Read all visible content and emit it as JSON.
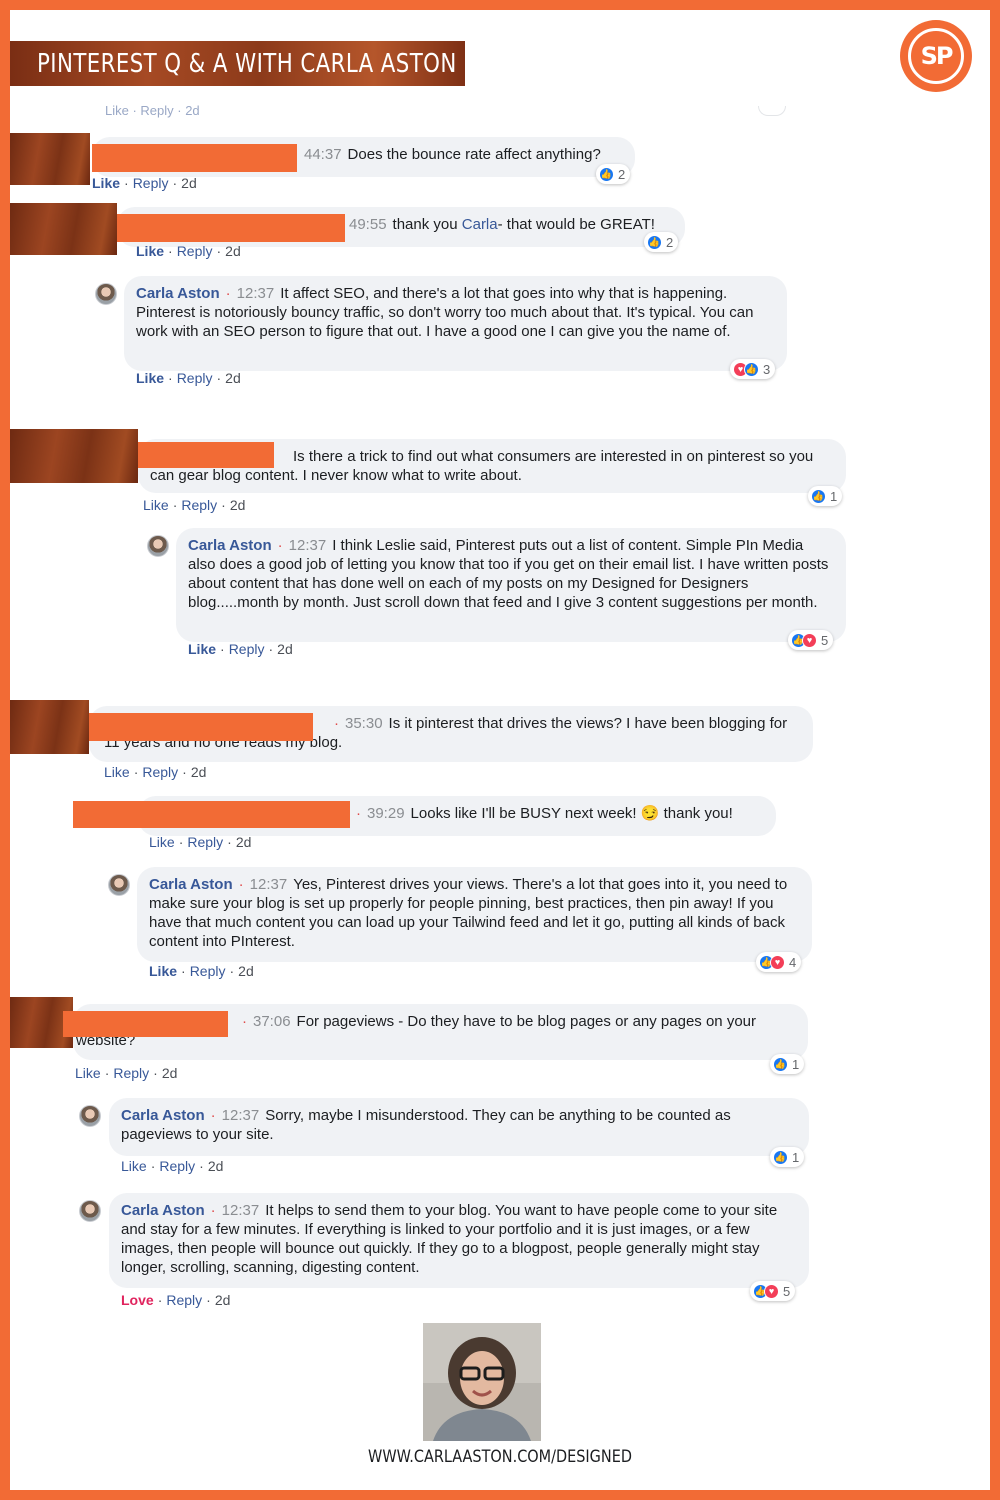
{
  "header": {
    "title": "PINTEREST Q & A WITH CARLA  ASTON",
    "logo_text": "SP"
  },
  "colors": {
    "brand_orange": "#f26b35",
    "link_blue": "#385898",
    "bubble_bg": "#f0f2f5",
    "love_red": "#e0245e"
  },
  "cut_top_text": "Like · Reply · 2d",
  "actions_common": {
    "like": "Like",
    "reply": "Reply",
    "sep": "·",
    "time": "2d",
    "love": "Love"
  },
  "comments": [
    {
      "timestamp": "44:37",
      "text": "Does the bounce rate affect anything?",
      "reactions": "2"
    },
    {
      "timestamp": "49:55",
      "text_pre": "thank you ",
      "mention": "Carla",
      "text_post": "- that would be GREAT!",
      "reactions": "2"
    },
    {
      "name": "Carla Aston",
      "dot": "·",
      "timestamp": "12:37",
      "text": "It affect SEO, and there's a lot that goes into why that is happening. Pinterest is notoriously bouncy traffic, so don't worry too much about that. It's typical. You can work with an SEO person to figure that out. I have a good one I can give you the name of.",
      "reactions": "3"
    },
    {
      "text": "Is there a trick to find out what consumers are interested in on pinterest so you can gear blog content. I never know what to write about.",
      "reactions": "1"
    },
    {
      "name": "Carla Aston",
      "dot": "·",
      "timestamp": "12:37",
      "text": "I think Leslie said, Pinterest puts out a list of content. Simple PIn Media also does a good job of letting you know that too if you get on their email list. I have written posts about content that has done well on each of my posts on my Designed for Designers blog.....month by month. Just scroll down that feed and I give 3 content suggestions per month.",
      "reactions": "5"
    },
    {
      "dot": "·",
      "timestamp": "35:30",
      "text": "Is it pinterest that drives the views? I have been blogging for 11 years and no one reads my blog."
    },
    {
      "dot": "·",
      "timestamp": "39:29",
      "text": "Looks like I'll be BUSY next week! 😏 thank you!"
    },
    {
      "name": "Carla Aston",
      "dot": "·",
      "timestamp": "12:37",
      "text": "Yes, Pinterest drives your views. There's a lot that goes into it, you need to make sure your blog is set up properly for people pinning, best practices, then pin away! If you have that much content you can load up your Tailwind feed and let it go, putting all kinds of back content into PInterest.",
      "reactions": "4"
    },
    {
      "dot": "·",
      "timestamp": "37:06",
      "text": "For pageviews - Do they have to be blog pages or any pages on your website?",
      "reactions": "1"
    },
    {
      "name": "Carla Aston",
      "dot": "·",
      "timestamp": "12:37",
      "text": "Sorry, maybe I misunderstood. They can be anything to be counted as pageviews to your site.",
      "reactions": "1"
    },
    {
      "name": "Carla Aston",
      "dot": "·",
      "timestamp": "12:37",
      "text": "It helps to send them to your blog. You want to have people come to your site and stay for a few minutes. If everything is linked to your portfolio and it is just images, or a few images, then people will bounce out quickly. If they go to a blogpost, people generally might stay longer, scrolling, scanning, digesting content.",
      "reactions": "5"
    }
  ],
  "footer": {
    "url": "WWW.CARLAASTON.COM/DESIGNED"
  }
}
